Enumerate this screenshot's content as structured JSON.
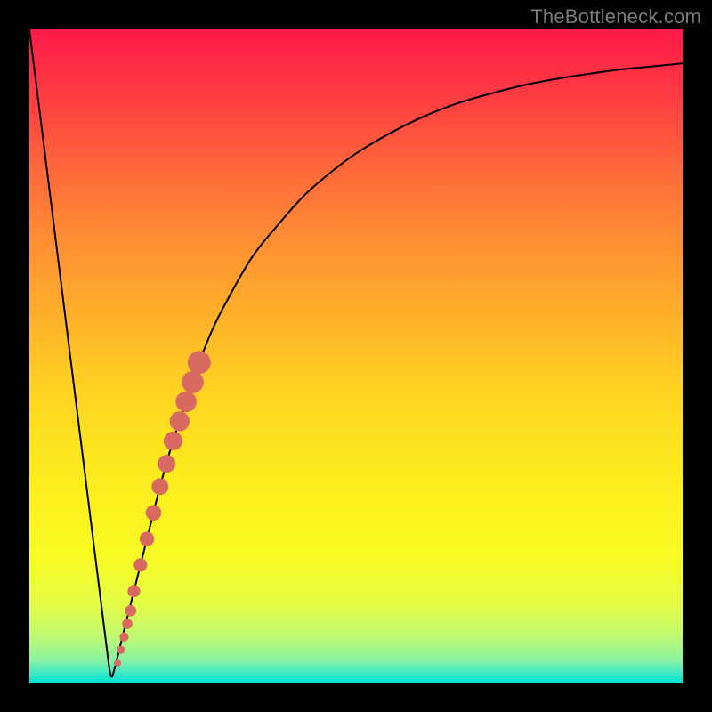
{
  "watermark": "TheBottleneck.com",
  "colors": {
    "frame": "#000000",
    "curve_stroke": "#000000",
    "marker_fill": "#d96a62",
    "gradient_top": "#ff1a49",
    "gradient_bottom": "#00e3d8"
  },
  "chart_data": {
    "type": "line",
    "title": "",
    "xlabel": "",
    "ylabel": "",
    "xlim": [
      0,
      100
    ],
    "ylim": [
      0,
      100
    ],
    "grid": false,
    "legend": false,
    "series": [
      {
        "name": "bottleneck-curve",
        "x": [
          0,
          2,
          4,
          6,
          8,
          10,
          11,
          12,
          12.5,
          13,
          14,
          15,
          16,
          18,
          20,
          22,
          24,
          26,
          28,
          30,
          34,
          38,
          42,
          46,
          50,
          55,
          60,
          65,
          70,
          75,
          80,
          85,
          90,
          95,
          100
        ],
        "y": [
          100,
          84,
          68,
          52,
          36,
          20,
          12,
          4,
          1,
          2,
          6,
          10,
          14,
          22,
          30,
          37,
          43,
          49,
          54,
          58,
          65,
          70,
          74.5,
          78,
          81,
          84,
          86.5,
          88.5,
          90,
          91.3,
          92.3,
          93.1,
          93.8,
          94.3,
          94.8
        ]
      }
    ],
    "markers": [
      {
        "name": "highlight-segment",
        "x": [
          13.5,
          14,
          14.5,
          15,
          15.5,
          16,
          17,
          18,
          19,
          20,
          21,
          22,
          23,
          24,
          25,
          26
        ],
        "y": [
          3,
          5,
          7,
          9,
          11,
          14,
          18,
          22,
          26,
          30,
          33.5,
          37,
          40,
          43,
          46,
          49
        ]
      }
    ]
  }
}
